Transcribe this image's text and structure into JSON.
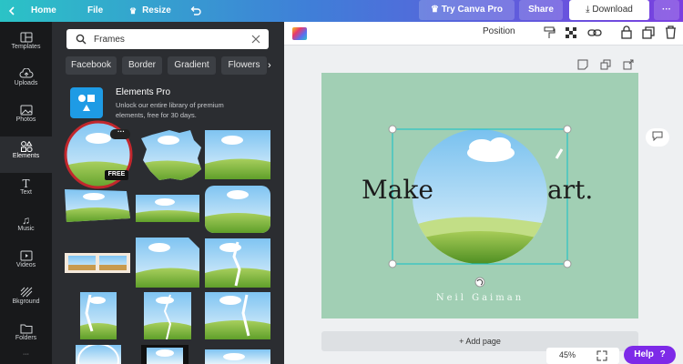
{
  "topbar": {
    "home": "Home",
    "file": "File",
    "resize": "Resize",
    "try_pro": "Try Canva Pro",
    "share": "Share",
    "download": "Download",
    "more": "···"
  },
  "rail": {
    "items": [
      {
        "label": "Templates",
        "icon": "templates-icon"
      },
      {
        "label": "Uploads",
        "icon": "upload-icon"
      },
      {
        "label": "Photos",
        "icon": "photos-icon"
      },
      {
        "label": "Elements",
        "icon": "elements-icon",
        "active": true
      },
      {
        "label": "Text",
        "icon": "text-icon"
      },
      {
        "label": "Music",
        "icon": "music-icon"
      },
      {
        "label": "Videos",
        "icon": "videos-icon"
      },
      {
        "label": "Bkground",
        "icon": "background-icon"
      },
      {
        "label": "Folders",
        "icon": "folders-icon"
      }
    ]
  },
  "panel": {
    "search_value": "Frames",
    "chips": [
      "Facebook",
      "Border",
      "Gradient",
      "Flowers"
    ],
    "promo": {
      "title": "Elements Pro",
      "desc_line1": "Unlock our entire library of premium",
      "desc_line2": "elements, free for 30 days."
    },
    "badge_free": "FREE",
    "badge_more": "···"
  },
  "toolbar2": {
    "position": "Position"
  },
  "canvas": {
    "text_left": "Make",
    "text_right": "art.",
    "author": "Neil Gaiman",
    "bg_color": "#a1cfb4"
  },
  "editor": {
    "add_page": "+ Add page",
    "zoom": "45%",
    "help": "Help",
    "help_icon": "?"
  },
  "colors": {
    "accent": "#7d2ae8",
    "selection": "#11c0c9",
    "panel": "#2b2d31",
    "rail": "#18191b"
  }
}
